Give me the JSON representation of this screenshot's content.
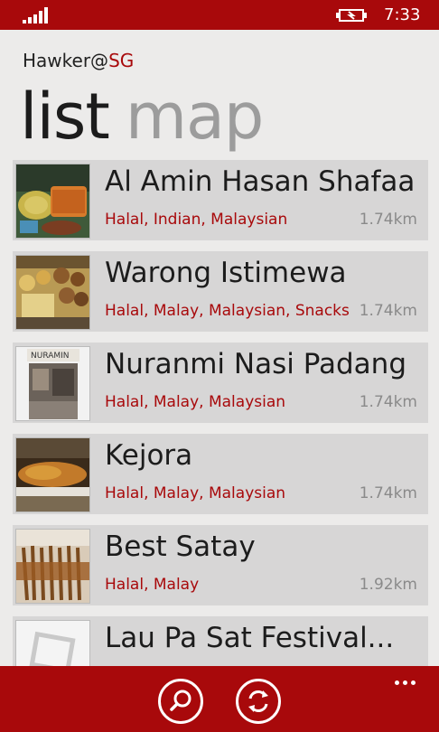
{
  "status_bar": {
    "time": "7:33"
  },
  "app": {
    "name_prefix": "Hawker@",
    "name_accent": "SG"
  },
  "pivot": {
    "active": "list",
    "inactive": "map"
  },
  "items": [
    {
      "name": "Al Amin Hasan Shafaa",
      "tags": "Halal, Indian, Malaysian",
      "distance": "1.74km"
    },
    {
      "name": "Warong Istimewa",
      "tags": "Halal, Malay, Malaysian, Snacks",
      "distance": "1.74km"
    },
    {
      "name": "Nuranmi Nasi Padang",
      "tags": "Halal, Malay, Malaysian",
      "distance": "1.74km"
    },
    {
      "name": "Kejora",
      "tags": "Halal, Malay, Malaysian",
      "distance": "1.74km"
    },
    {
      "name": "Best Satay",
      "tags": "Halal, Malay",
      "distance": "1.92km"
    },
    {
      "name": "Lau Pa Sat Festival...",
      "tags": "",
      "distance": ""
    }
  ],
  "thumb3_sign": "NURAMIN",
  "colors": {
    "accent": "#a8090b",
    "background": "#ecebea",
    "item_bg": "#d7d6d6"
  },
  "app_bar": {
    "buttons": [
      "search-icon",
      "refresh-icon"
    ],
    "more": "more-icon"
  }
}
